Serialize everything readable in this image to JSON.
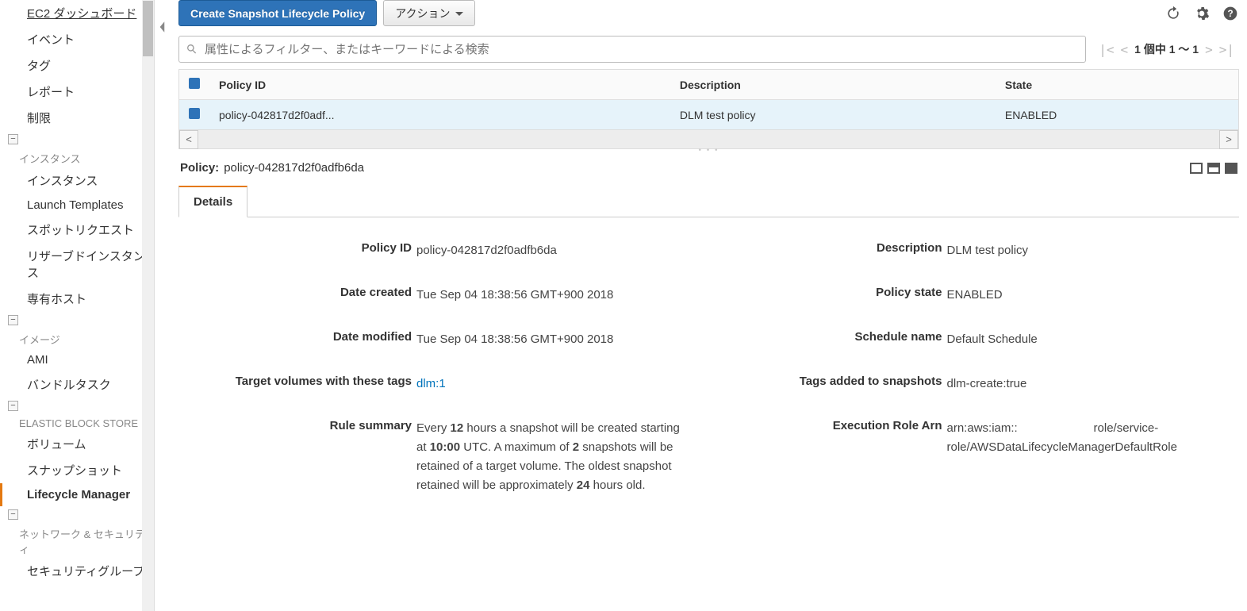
{
  "sidebar": {
    "items": [
      {
        "label": "EC2 ダッシュボード"
      },
      {
        "label": "イベント"
      },
      {
        "label": "タグ"
      },
      {
        "label": "レポート"
      },
      {
        "label": "制限"
      }
    ],
    "groups": [
      {
        "label": "インスタンス",
        "items": [
          "インスタンス",
          "Launch Templates",
          "スポットリクエスト",
          "リザーブドインスタンス",
          "専有ホスト"
        ]
      },
      {
        "label": "イメージ",
        "items": [
          "AMI",
          "バンドルタスク"
        ]
      },
      {
        "label": "ELASTIC BLOCK STORE",
        "items": [
          "ボリューム",
          "スナップショット",
          "Lifecycle Manager"
        ]
      },
      {
        "label": "ネットワーク & セキュリティ",
        "items": [
          "セキュリティグループ"
        ]
      }
    ]
  },
  "toolbar": {
    "create_label": "Create Snapshot Lifecycle Policy",
    "action_label": "アクション"
  },
  "search": {
    "placeholder": "属性によるフィルター、またはキーワードによる検索"
  },
  "pager": {
    "text": "1 個中 1 ～ 1"
  },
  "table": {
    "headers": {
      "policy_id": "Policy ID",
      "description": "Description",
      "state": "State"
    },
    "rows": [
      {
        "policy_id": "policy-042817d2f0adf...",
        "description": "DLM test policy",
        "state": "ENABLED"
      }
    ]
  },
  "detail_header": {
    "label": "Policy:",
    "value": "policy-042817d2f0adfb6da"
  },
  "tabs": {
    "details": "Details"
  },
  "details": {
    "policy_id_label": "Policy ID",
    "policy_id_value": "policy-042817d2f0adfb6da",
    "date_created_label": "Date created",
    "date_created_value": "Tue Sep 04 18:38:56 GMT+900 2018",
    "date_modified_label": "Date modified",
    "date_modified_value": "Tue Sep 04 18:38:56 GMT+900 2018",
    "target_tags_label": "Target volumes with these tags",
    "target_tags_value": "dlm:1",
    "rule_summary_label": "Rule summary",
    "rule_every": "Every ",
    "rule_12": "12",
    "rule_mid1": " hours a snapshot will be created starting at ",
    "rule_10": "10:00",
    "rule_mid2": " UTC. A maximum of ",
    "rule_2": "2",
    "rule_mid3": " snapshots will be retained of a target volume. The oldest snapshot retained will be approximately ",
    "rule_24": "24",
    "rule_end": " hours old.",
    "description_label": "Description",
    "description_value": "DLM test policy",
    "policy_state_label": "Policy state",
    "policy_state_value": "ENABLED",
    "schedule_name_label": "Schedule name",
    "schedule_name_value": "Default Schedule",
    "snapshot_tags_label": "Tags added to snapshots",
    "snapshot_tags_value": "dlm-create:true",
    "exec_role_label": "Execution Role Arn",
    "exec_role_value": "arn:aws:iam::                       role/service-role/AWSDataLifecycleManagerDefaultRole"
  }
}
